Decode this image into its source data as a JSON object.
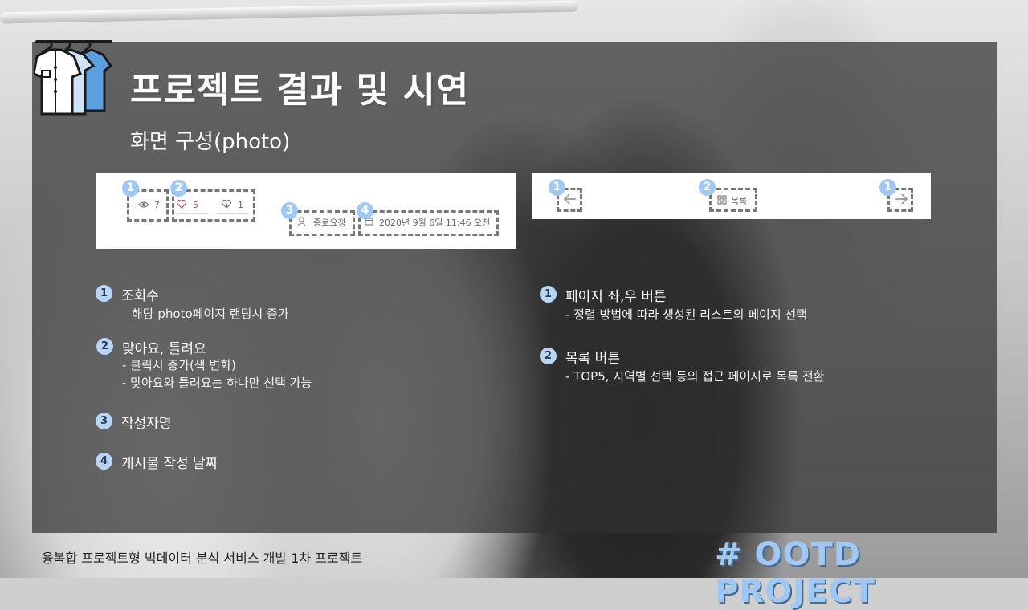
{
  "title": "프로젝트 결과 및 시연",
  "subtitle": "화면 구성(photo)",
  "panel_left": {
    "markers": [
      "1",
      "2",
      "3",
      "4"
    ],
    "views": "7",
    "likes": "5",
    "dislikes": "1",
    "author": "종로요정",
    "date": "2020년 9월 6일 11:46 오전",
    "icons": [
      "eye-icon",
      "heart-icon",
      "broken-heart-icon",
      "user-icon",
      "calendar-icon"
    ]
  },
  "panel_right": {
    "markers": [
      "1",
      "2",
      "1"
    ],
    "list_label": "목록",
    "icons": [
      "arrow-left-icon",
      "grid-icon",
      "arrow-right-icon"
    ]
  },
  "left_items": [
    {
      "num": "1",
      "heading": "조회수",
      "details": [
        "해당 photo페이지 랜딩시 증가"
      ]
    },
    {
      "num": "2",
      "heading": "맞아요, 틀려요",
      "details": [
        "- 클릭시 증가(색 변화)",
        "- 맞아요와 틀려요는 하나만 선택 가능"
      ]
    },
    {
      "num": "3",
      "heading": "작성자명",
      "details": []
    },
    {
      "num": "4",
      "heading": "게시물 작성 날짜",
      "details": []
    }
  ],
  "right_items": [
    {
      "num": "1",
      "heading": "페이지 좌,우 버튼",
      "details": [
        "- 정렬 방법에 따라 생성된 리스트의 페이지 선택"
      ]
    },
    {
      "num": "2",
      "heading": "목록 버튼",
      "details": [
        "- TOP5, 지역별 선택 등의 접근 페이지로 목록 전환"
      ]
    }
  ],
  "footer": "융복합 프로젝트형 빅데이터 분석 서비스 개발 1차 프로젝트",
  "brand": "# OOTD PROJECT",
  "colors": {
    "accent": "#9ec8f5",
    "overlay": "#303030",
    "heart": "#c9486b",
    "dash": "#777777"
  }
}
